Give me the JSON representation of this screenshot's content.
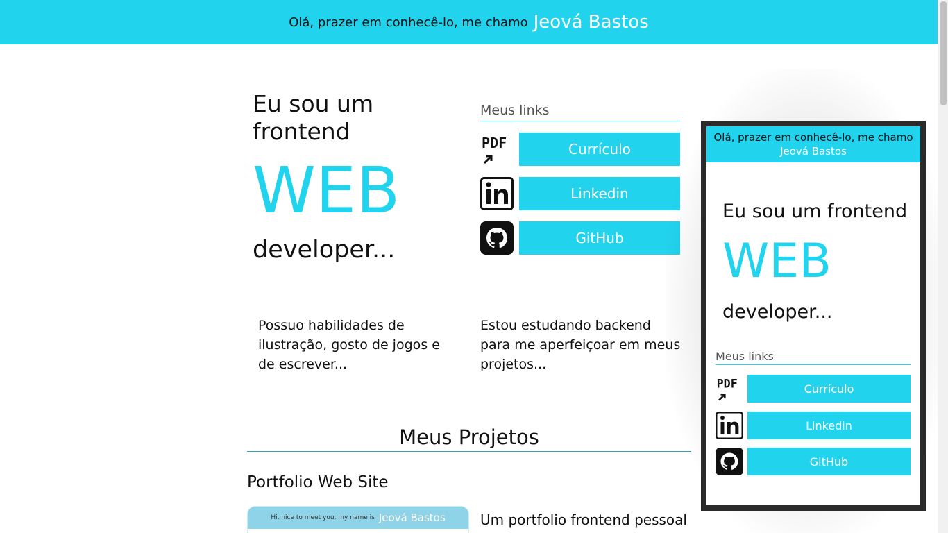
{
  "header": {
    "greeting": "Olá, prazer em conhecê-lo, me chamo",
    "name": "Jeová Bastos"
  },
  "hero": {
    "line1": "Eu sou um frontend",
    "highlight": "WEB",
    "line2": "developer..."
  },
  "links": {
    "title": "Meus links",
    "items": [
      {
        "label": "Currículo",
        "icon": "pdf-icon"
      },
      {
        "label": "Linkedin",
        "icon": "linkedin-icon"
      },
      {
        "label": "GitHub",
        "icon": "github-icon"
      }
    ]
  },
  "about": {
    "left": "Possuo habilidades de ilustração, gosto de jogos e de escrever...",
    "right": "Estou estudando backend para me aperfeiçoar em meus projetos..."
  },
  "projects": {
    "title": "Meus Projetos",
    "items": [
      {
        "name": "Portfolio Web Site",
        "thumb_greeting": "Hi, nice to meet you, my name is",
        "thumb_name": "Jeová Bastos",
        "description": "Um portfolio frontend pessoal"
      }
    ]
  },
  "preview": {
    "greeting": "Olá, prazer em conhecê-lo, me chamo",
    "name": "Jeová Bastos",
    "line1": "Eu sou um frontend",
    "highlight": "WEB",
    "line2": "developer...",
    "links_title": "Meus links",
    "links": [
      "Currículo",
      "Linkedin",
      "GitHub"
    ]
  },
  "colors": {
    "accent": "#22d3ee",
    "text": "#111111",
    "frame": "#2b2b2b"
  }
}
